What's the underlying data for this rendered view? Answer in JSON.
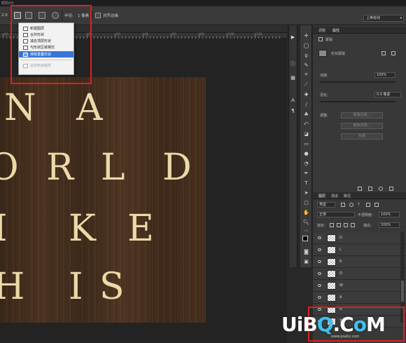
{
  "window": {
    "title": "帮助(H)"
  },
  "options_bar": {
    "zoom_prefix": "2.0",
    "radius_label": "半径:",
    "radius_value": "1 像素",
    "align_edges_label": "对齐边缘",
    "workspace": "上等有线"
  },
  "ruler": {
    "labels": [
      "60",
      "40",
      "20",
      "0",
      "20",
      "40",
      "60",
      "80",
      "100",
      "120"
    ]
  },
  "path_menu": {
    "items": [
      {
        "label": "新建图层",
        "icon": "new-layer-icon",
        "checked": false,
        "selected": false,
        "disabled": false
      },
      {
        "label": "合并形状",
        "icon": "combine-shapes-icon",
        "checked": false,
        "selected": false,
        "disabled": false
      },
      {
        "label": "减去顶层形状",
        "icon": "subtract-front-icon",
        "checked": false,
        "selected": false,
        "disabled": false
      },
      {
        "label": "与形状区域相交",
        "icon": "intersect-shapes-icon",
        "checked": false,
        "selected": false,
        "disabled": false
      },
      {
        "label": "排除重叠形状",
        "icon": "exclude-overlap-icon",
        "checked": true,
        "selected": true,
        "disabled": false
      },
      {
        "label": "合并形状组件",
        "icon": "merge-components-icon",
        "checked": false,
        "selected": false,
        "disabled": true
      }
    ]
  },
  "canvas": {
    "lines": [
      {
        "letters": [
          "N",
          "A"
        ]
      },
      {
        "letters": [
          "O",
          "R",
          "L",
          "D"
        ]
      },
      {
        "letters": [
          "I",
          "K",
          "E"
        ]
      },
      {
        "letters": [
          "H",
          "I",
          "S"
        ]
      }
    ]
  },
  "properties_panel": {
    "tabs": [
      "调整",
      "属性"
    ],
    "mask_label": "蒙版",
    "shape_label": "形状蒙版",
    "density_label": "浓度:",
    "density_value": "100%",
    "feather_label": "羽化:",
    "feather_value": "0.0 像素",
    "refine_label": "调整:",
    "btn_mask_edge": "蒙版边缘...",
    "btn_color_range": "颜色范围...",
    "btn_invert": "反相"
  },
  "layers_panel": {
    "tabs": [
      "图层",
      "通道",
      "路径"
    ],
    "filter_kind": "类型",
    "blend_mode": "正常",
    "opacity_label": "不透明度:",
    "opacity_value": "100%",
    "lock_label": "锁定:",
    "fill_label": "填充:",
    "fill_value": "100%",
    "layers": [
      "D",
      "L",
      "R",
      "O",
      "W",
      "A",
      "N",
      "T"
    ]
  },
  "watermark": {
    "text": "UiBQ.CoM",
    "sub": "www.psahz.com"
  },
  "colors": {
    "accent": "#3875d7",
    "annotation": "#e02020",
    "letters": "#ebd9a8"
  }
}
